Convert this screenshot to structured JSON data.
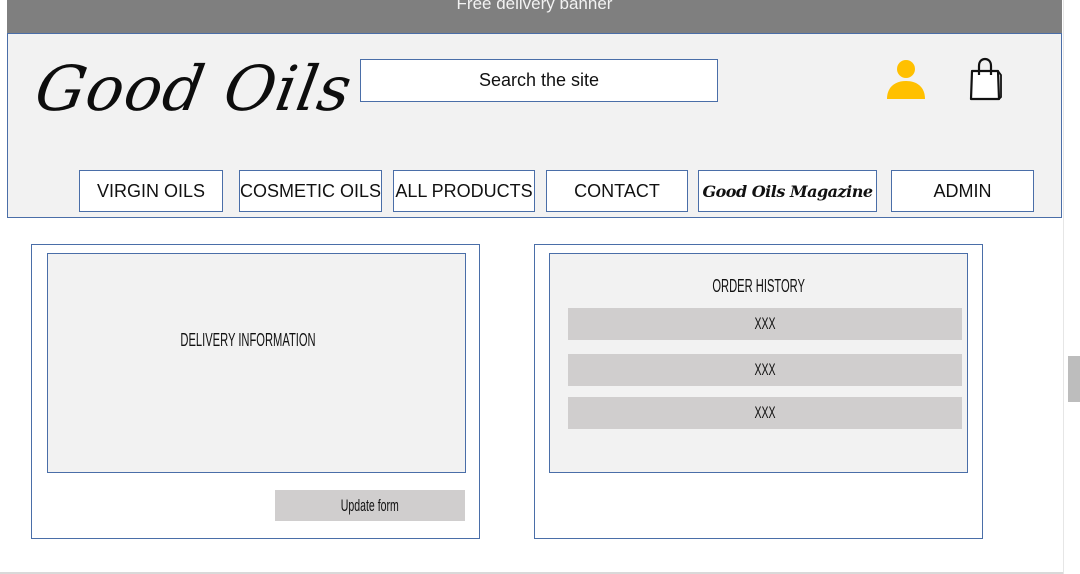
{
  "banner": {
    "text": "Free delivery banner",
    "background": "#7f7f7f"
  },
  "header": {
    "logo": "Good Oils",
    "search_placeholder": "Search the site",
    "icons": {
      "account": "user-icon",
      "cart": "shopping-bag-icon"
    },
    "account_icon_color": "#ffc000"
  },
  "nav": {
    "items": [
      {
        "label": "VIRGIN OILS"
      },
      {
        "label": "COSMETIC OILS"
      },
      {
        "label": "ALL PRODUCTS"
      },
      {
        "label": "CONTACT"
      },
      {
        "label": "Good Oils Magazine"
      },
      {
        "label": "ADMIN"
      }
    ]
  },
  "delivery": {
    "title": "DELIVERY INFORMATION",
    "button_label": "Update form"
  },
  "orders": {
    "title": "ORDER HISTORY",
    "rows": [
      {
        "label": "XXX"
      },
      {
        "label": "XXX"
      },
      {
        "label": "XXX"
      }
    ]
  },
  "colors": {
    "border": "#4a6ea8",
    "panel_fill": "#f2f2f2",
    "row_fill": "#d0cece"
  }
}
